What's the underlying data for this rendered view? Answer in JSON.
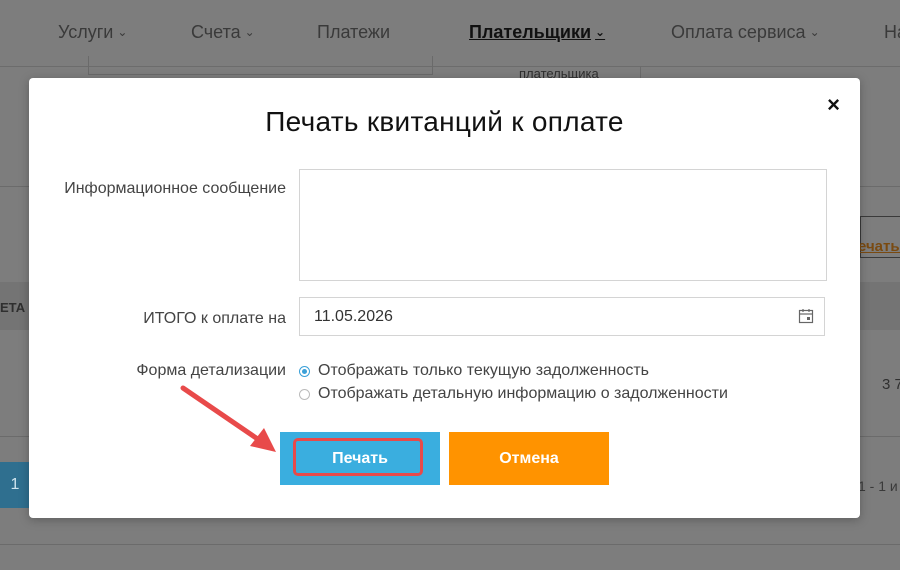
{
  "nav": {
    "items": [
      {
        "label": "Услуги",
        "chevron": true
      },
      {
        "label": "Счета",
        "chevron": true
      },
      {
        "label": "Платежи",
        "chevron": false
      },
      {
        "label": "Плательщики",
        "chevron": true,
        "active": true
      },
      {
        "label": "Оплата сервиса",
        "chevron": true
      },
      {
        "label": "На",
        "chevron": false
      }
    ]
  },
  "background": {
    "partial_text_1": "плательщика",
    "partial_text_2": "ЕТА",
    "partial_link": "ечать к",
    "partial_amount": "3 7",
    "pager_number": "1",
    "pager_info": "1 - 1 и"
  },
  "modal": {
    "title": "Печать квитанций к оплате",
    "close_symbol": "×",
    "info_message_label": "Информационное сообщение",
    "info_message_value": "",
    "total_label": "ИТОГО к оплате на",
    "total_date": "11.05.2026",
    "detail_label": "Форма детализации",
    "detail_options": [
      {
        "label": "Отображать только текущую задолженность",
        "checked": true
      },
      {
        "label": "Отображать детальную информацию о задолженности",
        "checked": false
      }
    ],
    "print_button": "Печать",
    "cancel_button": "Отмена"
  },
  "colors": {
    "print": "#3aaedf",
    "cancel": "#ff9300",
    "highlight": "#e84a4a"
  }
}
